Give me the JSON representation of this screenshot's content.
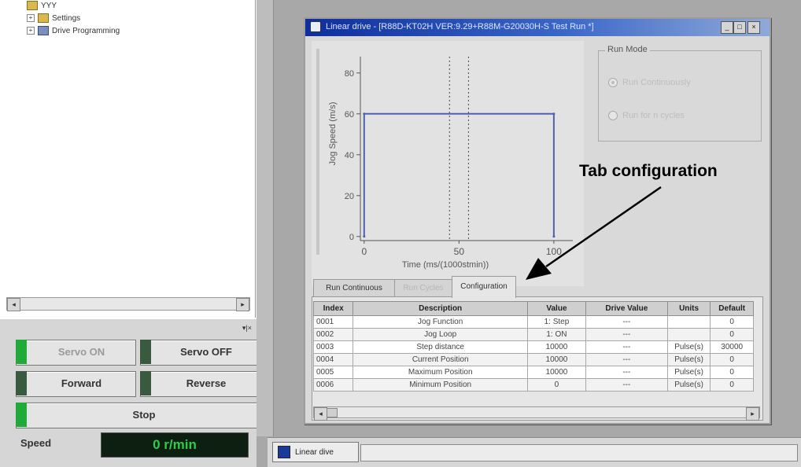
{
  "tree": {
    "items": [
      {
        "label": "YYY"
      },
      {
        "label": "Settings"
      },
      {
        "label": "Drive Programming"
      }
    ]
  },
  "control": {
    "servo_on": "Servo ON",
    "servo_off": "Servo OFF",
    "forward": "Forward",
    "reverse": "Reverse",
    "stop": "Stop",
    "speed_label": "Speed",
    "speed_value": "0 r/min",
    "led_on": "#1faa3a",
    "led_off": "#3a5a40"
  },
  "window": {
    "title": "Linear drive - [R88D-KT02H VER:9.29+R88M-G20030H-S Test Run *]",
    "minimize": "_",
    "maximize": "□",
    "close": "×"
  },
  "chart_data": {
    "type": "line",
    "xlabel": "Time (ms/(1000stmin))",
    "ylabel": "Jog Speed (m/s)",
    "xlim": [
      -2,
      110
    ],
    "ylim": [
      -2,
      88
    ],
    "xticks": [
      {
        "v": 0,
        "t": "0"
      },
      {
        "v": 50,
        "t": "50"
      },
      {
        "v": 100,
        "t": "100"
      }
    ],
    "yticks": [
      {
        "v": 0,
        "t": "0"
      },
      {
        "v": 20,
        "t": "20"
      },
      {
        "v": 40,
        "t": "40"
      },
      {
        "v": 60,
        "t": "60"
      },
      {
        "v": 80,
        "t": "80"
      }
    ],
    "series": [
      {
        "x": [
          0,
          0,
          100,
          100
        ],
        "y": [
          0,
          60,
          60,
          0
        ]
      }
    ],
    "vlines": [
      45,
      55
    ],
    "grid": false
  },
  "run_mode": {
    "title": "Run Mode",
    "option1": "Run Continuously",
    "option2": "Run for n cycles",
    "selected": "Run Continuously"
  },
  "tabs": [
    {
      "label": "Run Continuous",
      "state": "normal"
    },
    {
      "label": "Run Cycles",
      "state": "disabled"
    },
    {
      "label": "Configuration",
      "state": "active"
    }
  ],
  "table": {
    "headers": [
      "Index",
      "Description",
      "Value",
      "Drive Value",
      "Units",
      "Default"
    ],
    "rows": [
      {
        "index": "0001",
        "description": "Jog Function",
        "value": "1: Step",
        "drive": "---",
        "units": "",
        "default": "0"
      },
      {
        "index": "0002",
        "description": "Jog Loop",
        "value": "1: ON",
        "drive": "---",
        "units": "",
        "default": "0"
      },
      {
        "index": "0003",
        "description": "Step distance",
        "value": "10000",
        "drive": "---",
        "units": "Pulse(s)",
        "default": "30000"
      },
      {
        "index": "0004",
        "description": "Current Position",
        "value": "10000",
        "drive": "---",
        "units": "Pulse(s)",
        "default": "0"
      },
      {
        "index": "0005",
        "description": "Maximum Position",
        "value": "10000",
        "drive": "---",
        "units": "Pulse(s)",
        "default": "0"
      },
      {
        "index": "0006",
        "description": "Minimum Position",
        "value": "0",
        "drive": "---",
        "units": "Pulse(s)",
        "default": "0"
      }
    ]
  },
  "statusbar": {
    "task_tab": "Linear dive"
  },
  "annotation": {
    "label": "Tab configuration"
  }
}
